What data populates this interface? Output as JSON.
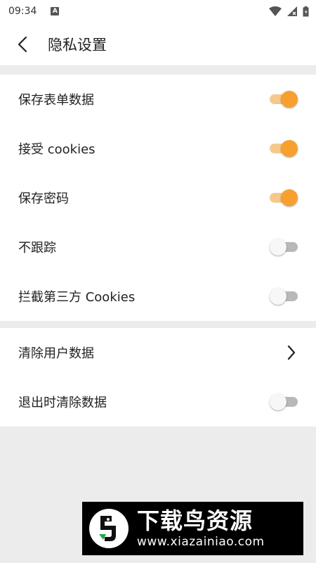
{
  "status": {
    "time": "09:34",
    "a_badge": "A"
  },
  "header": {
    "title": "隐私设置"
  },
  "section1": {
    "items": [
      {
        "label": "保存表单数据",
        "on": true
      },
      {
        "label": "接受 cookies",
        "on": true
      },
      {
        "label": "保存密码",
        "on": true
      },
      {
        "label": "不跟踪",
        "on": false
      },
      {
        "label": "拦截第三方 Cookies",
        "on": false
      }
    ]
  },
  "section2": {
    "clear": {
      "label": "清除用户数据"
    },
    "exit_clear": {
      "label": "退出时清除数据",
      "on": false
    }
  },
  "watermark": {
    "name": "下载鸟资源",
    "url": "www.xiazainiao.com"
  },
  "colors": {
    "accent": "#f7a030",
    "accent_track": "#f6c98a",
    "off_track": "#b8b8b8",
    "background": "#ececec"
  }
}
